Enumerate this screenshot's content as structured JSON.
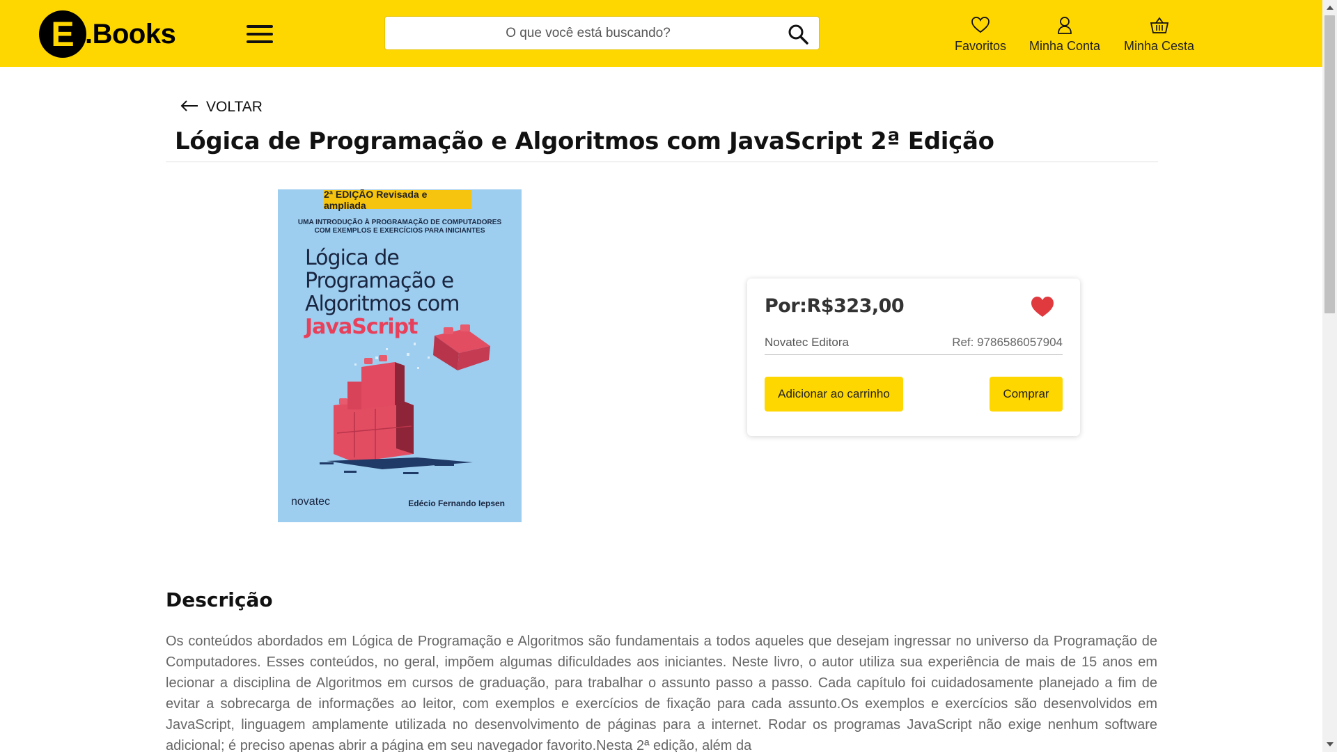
{
  "header": {
    "logo_letter": "E",
    "logo_text": ".Books",
    "search_placeholder": "O que você está buscando?",
    "nav": {
      "favorites": "Favoritos",
      "account": "Minha Conta",
      "basket": "Minha Cesta"
    }
  },
  "back_label": "VOLTAR",
  "title": "Lógica de Programação e Algoritmos com JavaScript 2ª Edição",
  "cover": {
    "badge": "2ª EDIÇÃO Revisada e ampliada",
    "subtitle_line1": "UMA INTRODUÇÃO À PROGRAMAÇÃO DE COMPUTADORES",
    "subtitle_line2": "COM EXEMPLOS E EXERCÍCIOS PARA INICIANTES",
    "title_line1": "Lógica de",
    "title_line2": "Programação e",
    "title_line3": "Algoritmos com",
    "title_js": "JavaScript",
    "publisher": "novatec",
    "author": "Edécio Fernando Iepsen"
  },
  "card": {
    "price": "Por:R$323,00",
    "publisher": "Novatec Editora",
    "ref": "Ref: 9786586057904",
    "add_to_cart": "Adicionar ao carrinho",
    "buy": "Comprar"
  },
  "description": {
    "heading": "Descrição",
    "text": "Os conteúdos abordados em Lógica de Programação e Algoritmos são fundamentais a todos aqueles que desejam ingressar no universo da Programação de Computadores. Esses conteúdos, no geral, impõem algumas dificuldades aos iniciantes. Neste livro, o autor utiliza sua experiência de mais de 15 anos em lecionar a disciplina de Algoritmos em cursos de graduação, para trabalhar o assunto passo a passo. Cada capítulo foi cuidadosamente planejado a fim de evitar a sobrecarga de informações ao leitor, com exemplos e exercícios de fixação para cada assunto.Os exemplos e exercícios são desenvolvidos em JavaScript, linguagem amplamente utilizada no desenvolvimento de páginas para a internet. Rodar os programas JavaScript não exige nenhum software adicional; é preciso apenas abrir a página em seu navegador favorito.Nesta 2ª edição, além da"
  },
  "colors": {
    "brand_yellow": "#ffd700",
    "heart_red": "#e0393e",
    "cover_blue": "#9dcdef"
  },
  "icons": {
    "search": "search-icon",
    "favorites": "heart-outline-icon",
    "account": "user-icon",
    "basket": "basket-icon",
    "back": "arrow-left-icon",
    "favorite_filled": "heart-filled-icon",
    "menu": "hamburger-menu-icon"
  }
}
